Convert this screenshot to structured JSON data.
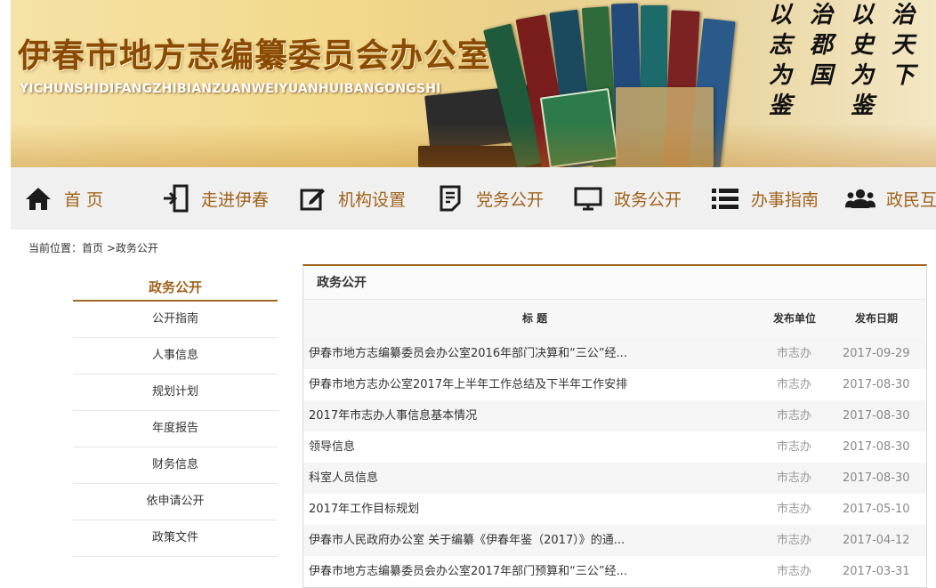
{
  "header": {
    "title": "伊春市地方志编纂委员会办公室",
    "pinyin": "YICHUNSHIDIFANGZHIBIANZUANWEIYUANHUIBANGONGSHI",
    "calligraphy": [
      "以志为鉴",
      "治郡国",
      "以史为鉴",
      "治天下"
    ]
  },
  "nav": [
    {
      "label": "首 页",
      "icon": "home-icon"
    },
    {
      "label": "走进伊春",
      "icon": "enter-icon"
    },
    {
      "label": "机构设置",
      "icon": "edit-icon"
    },
    {
      "label": "党务公开",
      "icon": "document-icon"
    },
    {
      "label": "政务公开",
      "icon": "monitor-icon"
    },
    {
      "label": "办事指南",
      "icon": "list-icon"
    },
    {
      "label": "政民互",
      "icon": "people-icon"
    }
  ],
  "breadcrumb": {
    "prefix": "当前位置：",
    "home": "首页",
    "sep": " >",
    "current": "政务公开"
  },
  "sidebar": {
    "title": "政务公开",
    "items": [
      "公开指南",
      "人事信息",
      "规划计划",
      "年度报告",
      "财务信息",
      "依申请公开",
      "政策文件"
    ]
  },
  "main": {
    "title": "政务公开",
    "columns": {
      "title": "标    题",
      "unit": "发布单位",
      "date": "发布日期"
    },
    "rows": [
      {
        "title": "伊春市地方志编纂委员会办公室2016年部门决算和“三公”经...",
        "unit": "市志办",
        "date": "2017-09-29"
      },
      {
        "title": "伊春市地方志办公室2017年上半年工作总结及下半年工作安排",
        "unit": "市志办",
        "date": "2017-08-30"
      },
      {
        "title": "2017年市志办人事信息基本情况",
        "unit": "市志办",
        "date": "2017-08-30"
      },
      {
        "title": "领导信息",
        "unit": "市志办",
        "date": "2017-08-30"
      },
      {
        "title": "科室人员信息",
        "unit": "市志办",
        "date": "2017-08-30"
      },
      {
        "title": "2017年工作目标规划",
        "unit": "市志办",
        "date": "2017-05-10"
      },
      {
        "title": "伊春市人民政府办公室 关于编纂《伊春年鉴（2017）》的通...",
        "unit": "市志办",
        "date": "2017-04-12"
      },
      {
        "title": "伊春市地方志编纂委员会办公室2017年部门预算和“三公”经...",
        "unit": "市志办",
        "date": "2017-03-31"
      }
    ]
  },
  "colors": {
    "accent": "#a0631c",
    "title": "#8a4a00",
    "nav_bg": "#f0f0f0"
  }
}
